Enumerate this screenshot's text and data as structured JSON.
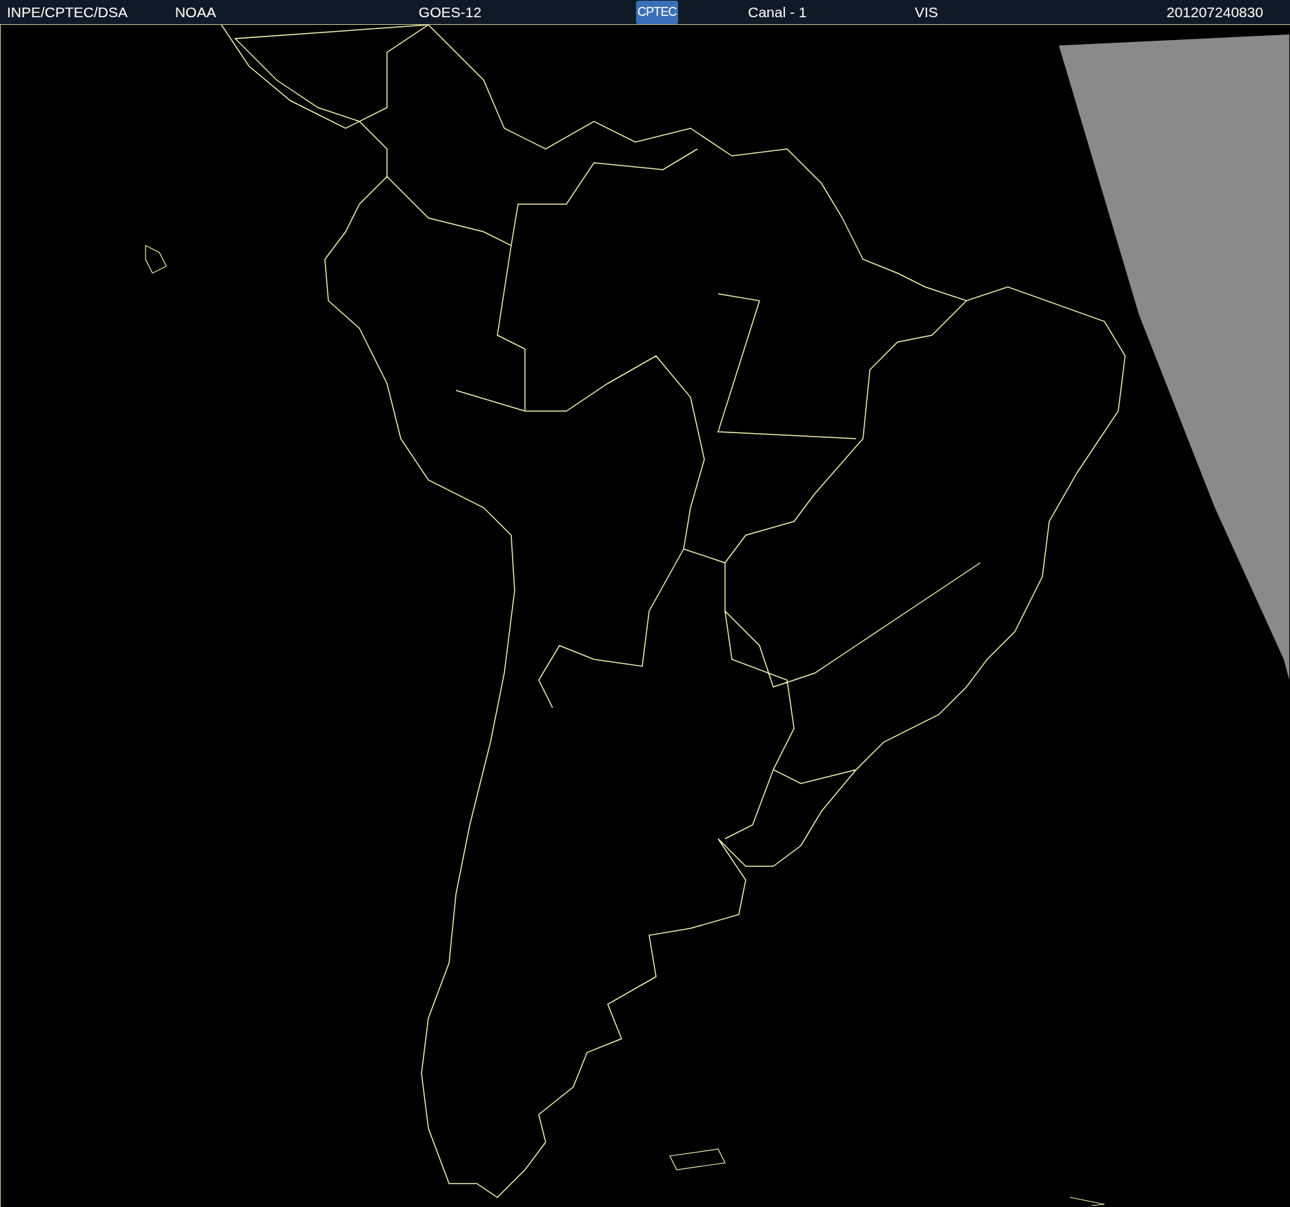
{
  "header": {
    "items": [
      {
        "kind": "text",
        "text": "INPE/CPTEC/DSA"
      },
      {
        "kind": "text",
        "text": "NOAA"
      },
      {
        "kind": "text",
        "text": "GOES-12"
      },
      {
        "kind": "logo",
        "text": "CPTEC"
      },
      {
        "kind": "text",
        "text": "Canal - 1"
      },
      {
        "kind": "text",
        "text": "VIS"
      },
      {
        "kind": "text",
        "text": "201207240830"
      }
    ]
  }
}
